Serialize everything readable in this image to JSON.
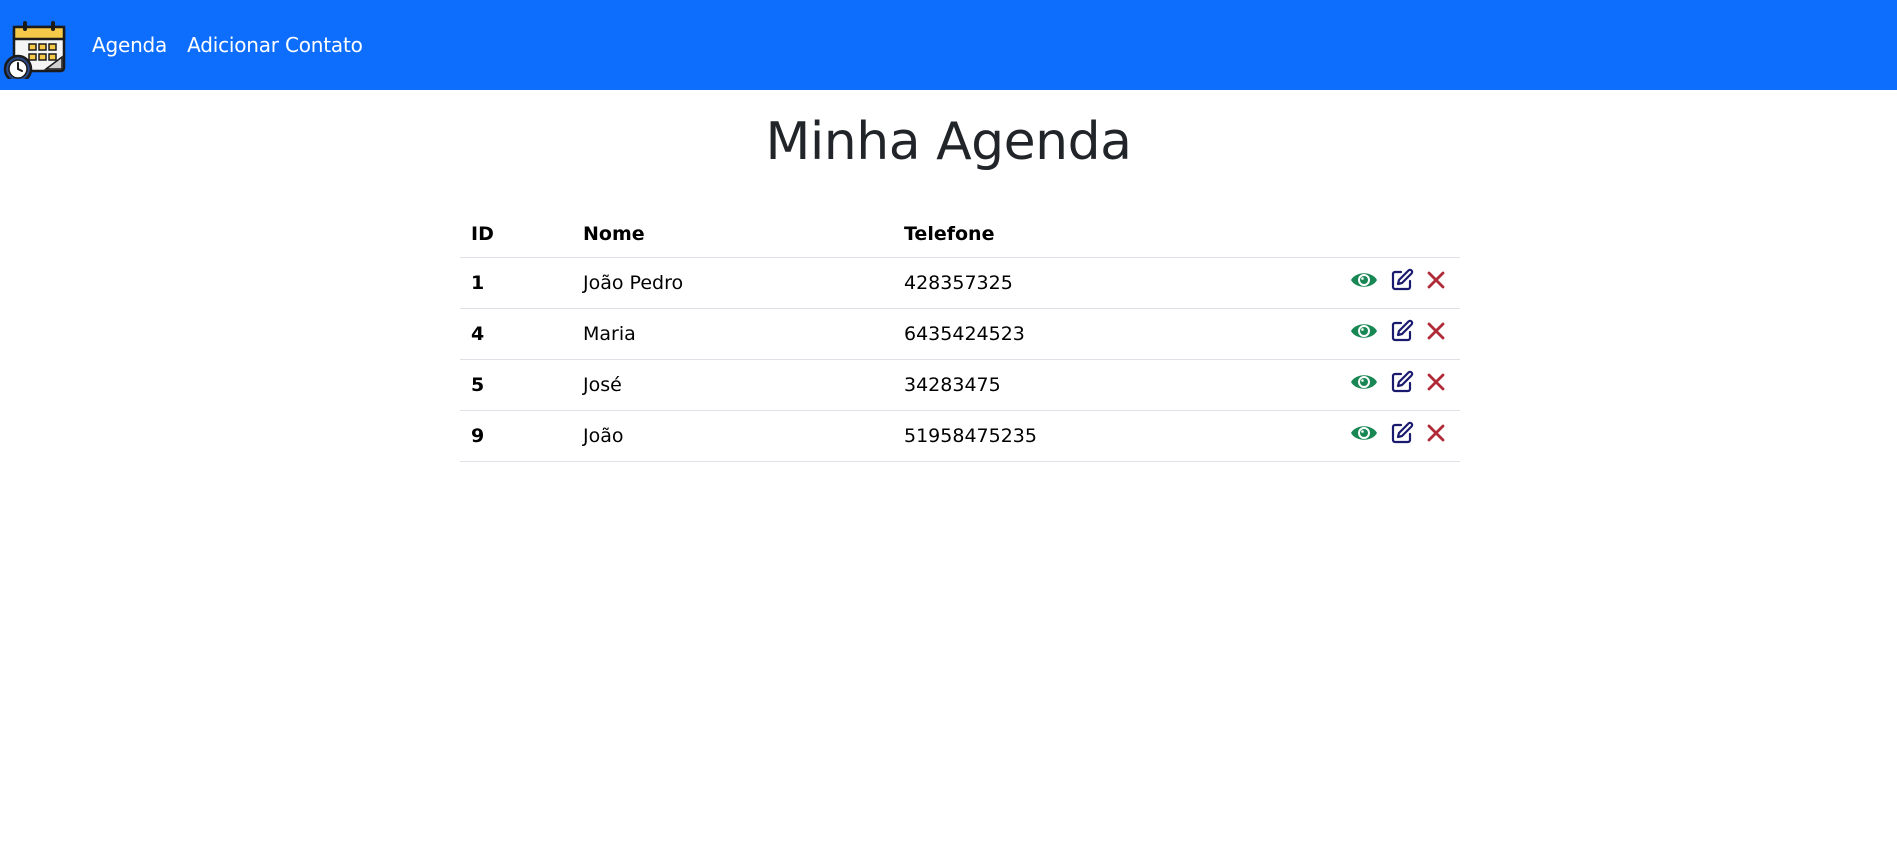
{
  "nav": {
    "logo_icon": "calendar-clock-icon",
    "links": [
      "Agenda",
      "Adicionar Contato"
    ]
  },
  "page": {
    "title": "Minha Agenda"
  },
  "table": {
    "headers": [
      "ID",
      "Nome",
      "Telefone",
      ""
    ],
    "rows": [
      {
        "id": "1",
        "nome": "João Pedro",
        "telefone": "428357325"
      },
      {
        "id": "4",
        "nome": "Maria",
        "telefone": "6435424523"
      },
      {
        "id": "5",
        "nome": "José",
        "telefone": "34283475"
      },
      {
        "id": "9",
        "nome": "João",
        "telefone": "51958475235"
      }
    ],
    "action_icons": [
      "eye-icon",
      "edit-icon",
      "close-icon"
    ]
  },
  "colors": {
    "navbar": "#0d6efd",
    "view": "#198754",
    "edit": "#1a1a6e",
    "delete": "#b02a37"
  }
}
